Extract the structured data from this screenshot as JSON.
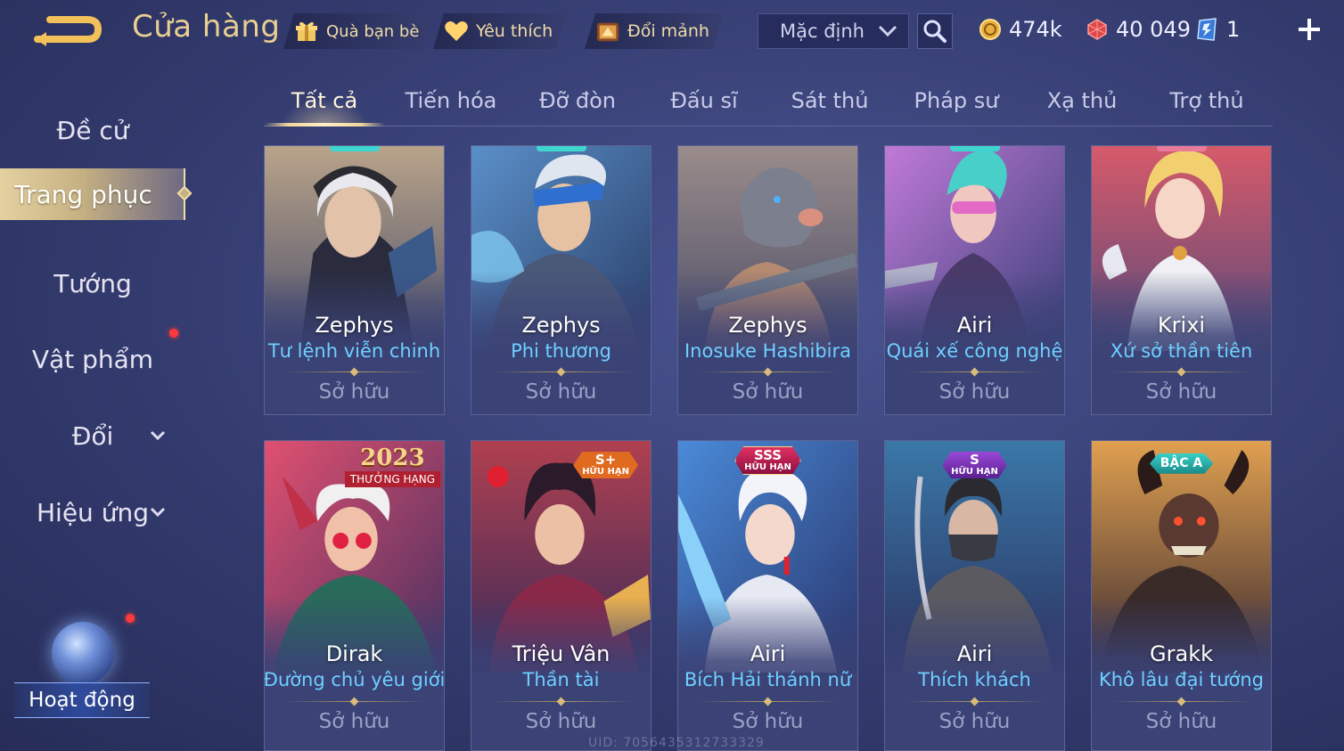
{
  "header": {
    "title": "Cửa hàng",
    "gift_label": "Quà bạn bè",
    "favorite_label": "Yêu thích",
    "exchange_label": "Đổi mảnh",
    "sort_value": "Mặc định"
  },
  "currencies": {
    "gold": "474k",
    "coupon": "40 049",
    "token": "1"
  },
  "sidebar": {
    "items": [
      {
        "label": "Đề cử"
      },
      {
        "label": "Trang phục"
      },
      {
        "label": "Tướng"
      },
      {
        "label": "Vật phẩm"
      },
      {
        "label": "Đổi"
      },
      {
        "label": "Hiệu ứng"
      }
    ],
    "event_label": "Hoạt động"
  },
  "tabs": [
    {
      "label": "Tất cả"
    },
    {
      "label": "Tiến hóa"
    },
    {
      "label": "Đỡ đòn"
    },
    {
      "label": "Đấu sĩ"
    },
    {
      "label": "Sát thủ"
    },
    {
      "label": "Pháp sư"
    },
    {
      "label": "Xạ thủ"
    },
    {
      "label": "Trợ thủ"
    }
  ],
  "cards": [
    {
      "hero": "Zephys",
      "skin": "Tư lệnh viễn chinh",
      "status": "Sở hữu",
      "badge": ""
    },
    {
      "hero": "Zephys",
      "skin": "Phi thương",
      "status": "Sở hữu",
      "badge": ""
    },
    {
      "hero": "Zephys",
      "skin": "Inosuke Hashibira",
      "status": "Sở hữu",
      "badge": ""
    },
    {
      "hero": "Airi",
      "skin": "Quái xế công nghệ",
      "status": "Sở hữu",
      "badge": ""
    },
    {
      "hero": "Krixi",
      "skin": "Xứ sở thần tiên",
      "status": "Sở hữu",
      "badge": ""
    },
    {
      "hero": "Dirak",
      "skin": "Đường chủ yêu giới",
      "status": "Sở hữu",
      "badge_title": "2023",
      "badge_sub": "THƯỞNG HẠNG"
    },
    {
      "hero": "Triệu Vân",
      "skin": "Thần tài",
      "status": "Sở hữu",
      "badge_title": "S+",
      "badge_sub": "HỮU HẠN"
    },
    {
      "hero": "Airi",
      "skin": "Bích Hải thánh nữ",
      "status": "Sở hữu",
      "badge_title": "SSS",
      "badge_sub": "HỮU HẠN"
    },
    {
      "hero": "Airi",
      "skin": "Thích khách",
      "status": "Sở hữu",
      "badge_title": "S",
      "badge_sub": "HỮU HẠN"
    },
    {
      "hero": "Grakk",
      "skin": "Khô lâu đại tướng",
      "status": "Sở hữu",
      "badge_title": "BẬC A"
    }
  ],
  "uid_text": "UID: 7056435312733329",
  "colors": {
    "accent_gold": "#e9cf92",
    "skin_name": "#6fd0ff",
    "notification": "#ff3a3a"
  }
}
